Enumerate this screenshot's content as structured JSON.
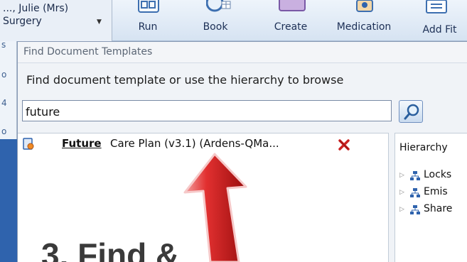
{
  "patient": {
    "name": "..., Julie (Mrs)",
    "practice": "Surgery"
  },
  "ribbon": {
    "buttons": [
      {
        "label": "Run",
        "icon": "grid-icon"
      },
      {
        "label": "Book",
        "icon": "clock-calendar-icon"
      },
      {
        "label": "Create",
        "icon": "document-icon"
      },
      {
        "label": "Medication",
        "icon": "medication-icon"
      },
      {
        "label": "Add Fit",
        "icon": "list-icon"
      }
    ]
  },
  "dialog": {
    "title": "Find Document Templates",
    "instruction": "Find document template or use the hierarchy to browse",
    "search": {
      "value": "future",
      "button_icon": "search-icon"
    },
    "results": [
      {
        "match": "Future",
        "rest": " Care Plan (v3.1) (Ardens-QMa...",
        "icon": "document-template-icon",
        "action_icon": "delete-icon"
      }
    ],
    "hierarchy": {
      "header": "Hierarchy",
      "items": [
        {
          "label": "Locks",
          "icon": "org-tree-icon"
        },
        {
          "label": "Emis",
          "icon": "org-tree-icon"
        },
        {
          "label": "Share",
          "icon": "org-tree-icon"
        }
      ]
    }
  },
  "overlay": {
    "caption": "3. Find &",
    "arrow_color": "#d42020"
  }
}
